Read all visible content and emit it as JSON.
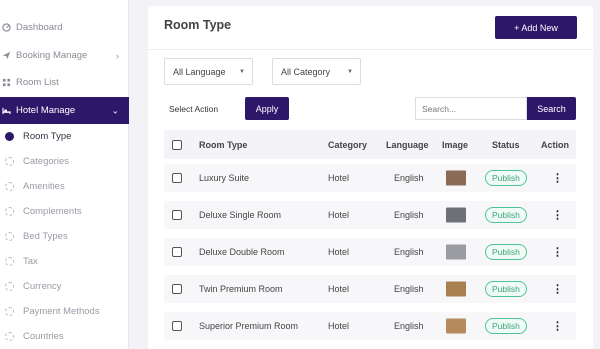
{
  "sidebar": {
    "items": [
      {
        "label": "Dashboard",
        "icon": "dashboard-icon"
      },
      {
        "label": "Booking Manage",
        "icon": "paper-plane-icon",
        "has_chevron": true
      },
      {
        "label": "Room List",
        "icon": "grid-icon"
      },
      {
        "label": "Hotel Manage",
        "icon": "bed-icon",
        "active": true,
        "expanded": true
      }
    ],
    "subitems": [
      {
        "label": "Room Type",
        "current": true
      },
      {
        "label": "Categories"
      },
      {
        "label": "Amenities"
      },
      {
        "label": "Complements"
      },
      {
        "label": "Bed Types"
      },
      {
        "label": "Tax"
      },
      {
        "label": "Currency"
      },
      {
        "label": "Payment Methods"
      },
      {
        "label": "Countries"
      }
    ]
  },
  "main": {
    "title": "Room Type",
    "add_button": "+ Add New",
    "filters": {
      "language": "All Language",
      "category": "All Category"
    },
    "bulk": {
      "select_label": "Select Action",
      "apply_label": "Apply"
    },
    "search": {
      "placeholder": "Search...",
      "button": "Search"
    }
  },
  "table": {
    "headers": {
      "room_type": "Room Type",
      "category": "Category",
      "language": "Language",
      "image": "Image",
      "status": "Status",
      "action": "Action"
    },
    "rows": [
      {
        "room_type": "Luxury Suite",
        "category": "Hotel",
        "language": "English",
        "status": "Publish",
        "thumb": "#8a6b55"
      },
      {
        "room_type": "Deluxe Single Room",
        "category": "Hotel",
        "language": "English",
        "status": "Publish",
        "thumb": "#6f7077"
      },
      {
        "room_type": "Deluxe Double Room",
        "category": "Hotel",
        "language": "English",
        "status": "Publish",
        "thumb": "#9a9ca2"
      },
      {
        "room_type": "Twin Premium Room",
        "category": "Hotel",
        "language": "English",
        "status": "Publish",
        "thumb": "#a8804f"
      },
      {
        "room_type": "Superior Premium Room",
        "category": "Hotel",
        "language": "English",
        "status": "Publish",
        "thumb": "#b58a5d"
      }
    ]
  },
  "colors": {
    "brand": "#2d1769",
    "publish_green": "#3aa47c"
  }
}
